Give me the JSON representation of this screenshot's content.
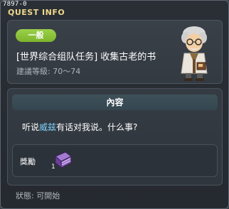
{
  "window": {
    "quest_id": "7897-0",
    "title": "QUEST INFO"
  },
  "quest": {
    "category": "一般",
    "name": "[世界综合组队任务] 收集古老的书",
    "level": "建議等級: 70～74"
  },
  "content": {
    "header": "內容",
    "dialogue_prefix": "听说",
    "dialogue_npc": "威兹",
    "dialogue_suffix": "有话对我说。什么事?"
  },
  "reward": {
    "label": "獎勵",
    "item_icon": "purple-book-icon",
    "item_count": "1"
  },
  "status": {
    "text": "狀態:  可開始"
  },
  "colors": {
    "title": "#f0d98a",
    "category_badge": "#8cc63c",
    "npc_name": "#7fd3ff"
  }
}
